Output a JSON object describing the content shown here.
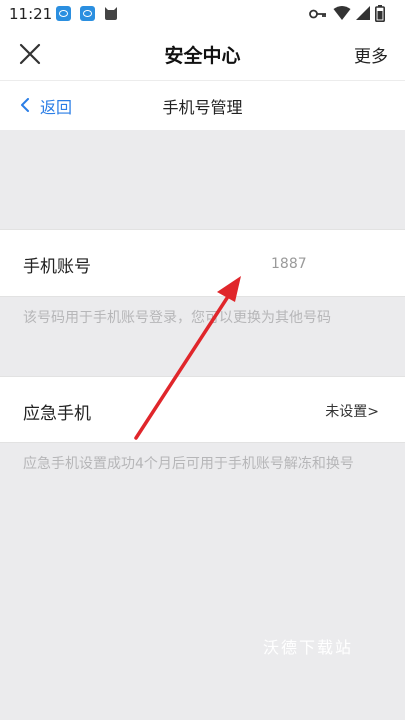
{
  "status_bar": {
    "time": "11:21",
    "notification_icons": [
      "app-notification-icon",
      "app-notification-icon",
      "cat-icon"
    ],
    "system_icons": [
      "key-icon",
      "wifi-icon",
      "signal-icon",
      "battery-icon"
    ]
  },
  "header": {
    "title": "安全中心",
    "more_label": "更多",
    "close_icon": "close-icon"
  },
  "sub_header": {
    "back_label": "返回",
    "title": "手机号管理"
  },
  "phone_account": {
    "label": "手机账号",
    "value": "1887",
    "description": "该号码用于手机账号登录，您可以更换为其他号码"
  },
  "emergency_phone": {
    "label": "应急手机",
    "value": "未设置>",
    "description": "应急手机设置成功4个月后可用于手机账号解冻和换号"
  },
  "watermark": "沃德下载站",
  "colors": {
    "accent": "#2b7ee6",
    "annotation_arrow": "#e0262b",
    "background": "#ebebed"
  }
}
